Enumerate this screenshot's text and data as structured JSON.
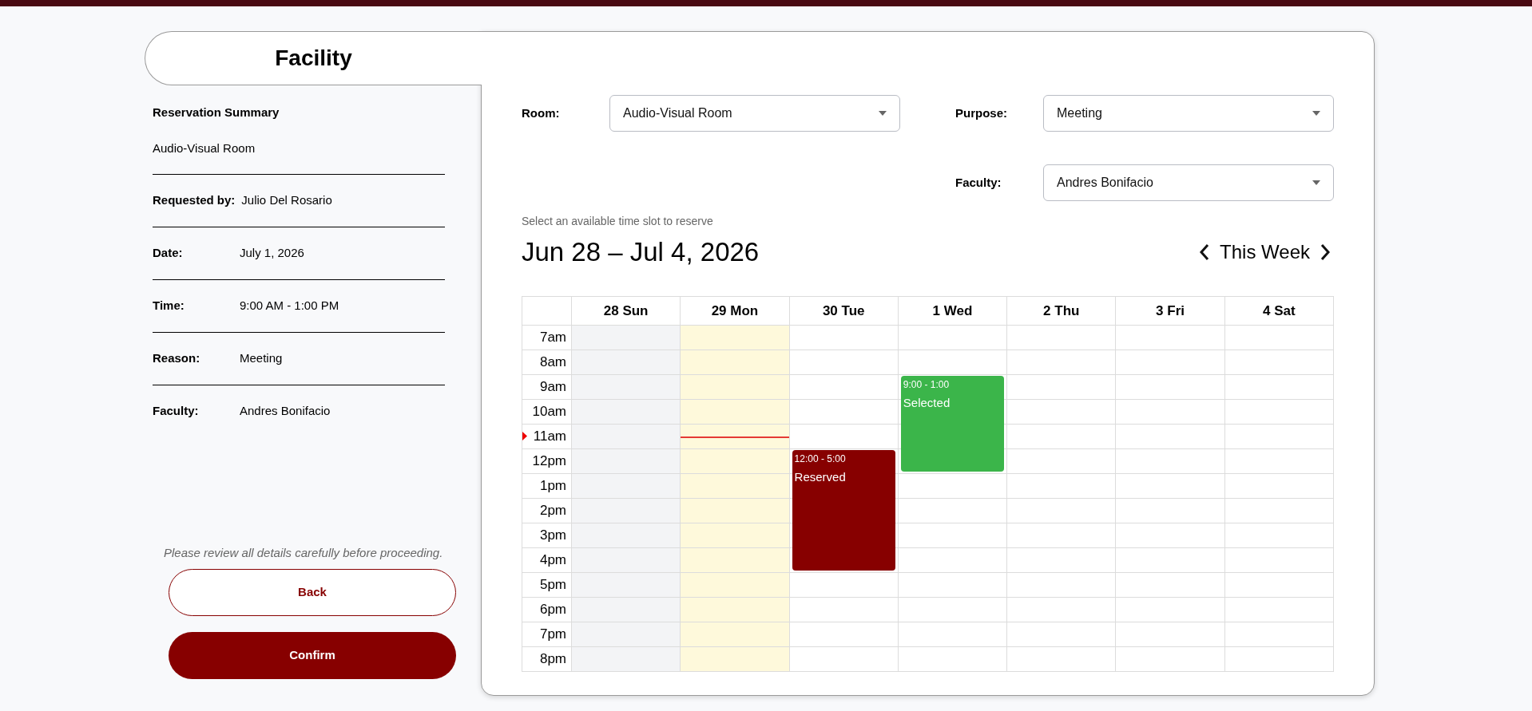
{
  "tab": {
    "title": "Facility"
  },
  "summary": {
    "title": "Reservation Summary",
    "room": "Audio-Visual Room",
    "rows": [
      {
        "label": "Requested by:",
        "value": "Julio Del Rosario",
        "kind": "inline"
      },
      {
        "label": "Date:",
        "value": "July 1, 2026",
        "kind": "column"
      },
      {
        "label": "Time:",
        "value": "9:00 AM - 1:00 PM",
        "kind": "column"
      },
      {
        "label": "Reason:",
        "value": "Meeting",
        "kind": "column"
      },
      {
        "label": "Faculty:",
        "value": "Andres Bonifacio",
        "kind": "column"
      }
    ],
    "note": "Please review all details carefully before proceeding.",
    "buttons": [
      {
        "label": "Back",
        "kind": "outline"
      },
      {
        "label": "Confirm",
        "kind": "primary"
      }
    ]
  },
  "form": {
    "room": {
      "label": "Room:",
      "value": "Audio-Visual Room"
    },
    "purpose": {
      "label": "Purpose:",
      "value": "Meeting"
    },
    "faculty": {
      "label": "Faculty:",
      "value": "Andres Bonifacio"
    }
  },
  "calendar": {
    "hint": "Select an available time slot to reserve",
    "range": "Jun 28 – Jul 4, 2026",
    "nav_label": "This Week",
    "hours": [
      "7am",
      "8am",
      "9am",
      "10am",
      "11am",
      "12pm",
      "1pm",
      "2pm",
      "3pm",
      "4pm",
      "5pm",
      "6pm",
      "7pm",
      "8pm"
    ],
    "days": [
      {
        "label": "28 Sun",
        "kind": "past",
        "cells": [
          {
            "kind": "free"
          },
          {
            "kind": "free"
          },
          {
            "kind": "free"
          },
          {
            "kind": "free"
          },
          {
            "kind": "free"
          },
          {
            "kind": "free"
          },
          {
            "kind": "free"
          },
          {
            "kind": "free"
          },
          {
            "kind": "free"
          },
          {
            "kind": "free"
          },
          {
            "kind": "free"
          },
          {
            "kind": "free"
          },
          {
            "kind": "free"
          },
          {
            "kind": "free"
          }
        ]
      },
      {
        "label": "29 Mon",
        "kind": "today",
        "cells": [
          {
            "kind": "free"
          },
          {
            "kind": "free"
          },
          {
            "kind": "free"
          },
          {
            "kind": "free"
          },
          {
            "kind": "now"
          },
          {
            "kind": "free"
          },
          {
            "kind": "free"
          },
          {
            "kind": "free"
          },
          {
            "kind": "free"
          },
          {
            "kind": "free"
          },
          {
            "kind": "free"
          },
          {
            "kind": "free"
          },
          {
            "kind": "free"
          },
          {
            "kind": "free"
          }
        ]
      },
      {
        "label": "30 Tue",
        "kind": "open",
        "cells": [
          {
            "kind": "free"
          },
          {
            "kind": "free"
          },
          {
            "kind": "free"
          },
          {
            "kind": "free"
          },
          {
            "kind": "free"
          },
          {
            "kind": "reserved",
            "event": {
              "time": "12:00 - 5:00",
              "label": "Reserved"
            }
          },
          {
            "kind": "reserved"
          },
          {
            "kind": "reserved"
          },
          {
            "kind": "reserved"
          },
          {
            "kind": "reserved"
          },
          {
            "kind": "free"
          },
          {
            "kind": "free"
          },
          {
            "kind": "free"
          },
          {
            "kind": "free"
          }
        ]
      },
      {
        "label": "1 Wed",
        "kind": "open",
        "cells": [
          {
            "kind": "free"
          },
          {
            "kind": "free"
          },
          {
            "kind": "selected",
            "event": {
              "time": "9:00 - 1:00",
              "label": "Selected"
            }
          },
          {
            "kind": "selected"
          },
          {
            "kind": "selected"
          },
          {
            "kind": "selected"
          },
          {
            "kind": "free"
          },
          {
            "kind": "free"
          },
          {
            "kind": "free"
          },
          {
            "kind": "free"
          },
          {
            "kind": "free"
          },
          {
            "kind": "free"
          },
          {
            "kind": "free"
          },
          {
            "kind": "free"
          }
        ]
      },
      {
        "label": "2 Thu",
        "kind": "open",
        "cells": [
          {
            "kind": "free"
          },
          {
            "kind": "free"
          },
          {
            "kind": "free"
          },
          {
            "kind": "free"
          },
          {
            "kind": "free"
          },
          {
            "kind": "free"
          },
          {
            "kind": "free"
          },
          {
            "kind": "free"
          },
          {
            "kind": "free"
          },
          {
            "kind": "free"
          },
          {
            "kind": "free"
          },
          {
            "kind": "free"
          },
          {
            "kind": "free"
          },
          {
            "kind": "free"
          }
        ]
      },
      {
        "label": "3 Fri",
        "kind": "open",
        "cells": [
          {
            "kind": "free"
          },
          {
            "kind": "free"
          },
          {
            "kind": "free"
          },
          {
            "kind": "free"
          },
          {
            "kind": "free"
          },
          {
            "kind": "free"
          },
          {
            "kind": "free"
          },
          {
            "kind": "free"
          },
          {
            "kind": "free"
          },
          {
            "kind": "free"
          },
          {
            "kind": "free"
          },
          {
            "kind": "free"
          },
          {
            "kind": "free"
          },
          {
            "kind": "free"
          }
        ]
      },
      {
        "label": "4 Sat",
        "kind": "open",
        "cells": [
          {
            "kind": "free"
          },
          {
            "kind": "free"
          },
          {
            "kind": "free"
          },
          {
            "kind": "free"
          },
          {
            "kind": "free"
          },
          {
            "kind": "free"
          },
          {
            "kind": "free"
          },
          {
            "kind": "free"
          },
          {
            "kind": "free"
          },
          {
            "kind": "free"
          },
          {
            "kind": "free"
          },
          {
            "kind": "free"
          },
          {
            "kind": "free"
          },
          {
            "kind": "free"
          }
        ]
      }
    ]
  }
}
